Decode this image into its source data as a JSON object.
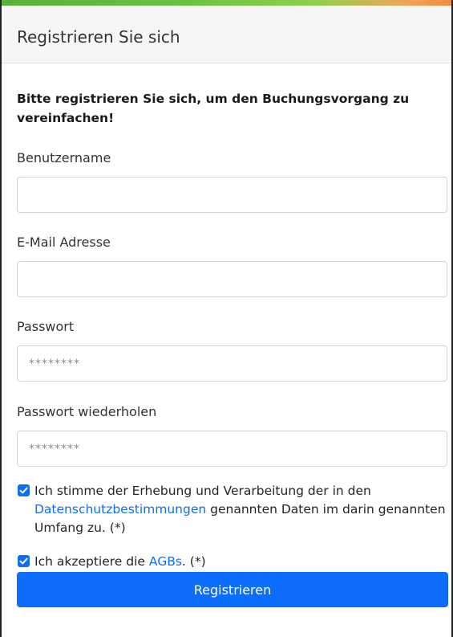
{
  "accent": "#0d6efd",
  "header": {
    "title": "Registrieren Sie sich"
  },
  "form": {
    "intro": "Bitte registrieren Sie sich, um den Buchungsvorgang zu vereinfachen!",
    "username": {
      "label": "Benutzername",
      "value": "",
      "placeholder": ""
    },
    "email": {
      "label": "E-Mail Adresse",
      "value": "",
      "placeholder": ""
    },
    "password": {
      "label": "Passwort",
      "value": "",
      "placeholder": "********"
    },
    "password_repeat": {
      "label": "Passwort wiederholen",
      "value": "",
      "placeholder": "********"
    },
    "privacy": {
      "checked": true,
      "text_before": "Ich stimme der Erhebung und Verarbeitung der in den ",
      "link": "Datenschutzbestimmungen",
      "text_after": " genannten Daten im darin genannten Umfang zu. (*)"
    },
    "terms": {
      "checked": true,
      "text_before": "Ich akzeptiere die ",
      "link": "AGBs",
      "text_after": ". (*)"
    },
    "submit_label": "Registrieren"
  }
}
